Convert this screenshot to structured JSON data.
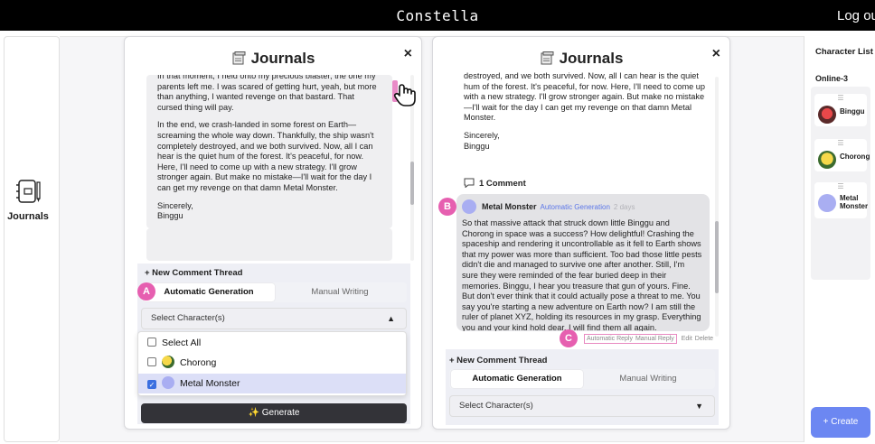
{
  "app": {
    "title": "Constella",
    "logout_label": "Log out"
  },
  "nav": {
    "journals_label": "Journals"
  },
  "panel_a": {
    "title": "Journals",
    "close_icon": "×",
    "text": [
      "In that moment, I held onto my precious blaster, the one my parents left me. I was scared of getting hurt, yeah, but more than anything, I wanted revenge on that bastard. That cursed thing will pay.",
      "In the end, we crash-landed in some forest on Earth—screaming the whole way down. Thankfully, the ship wasn't completely destroyed, and we both survived. Now, all I can hear is the quiet hum of the forest. It's peaceful, for now. Here, I'll need to come up with a new strategy. I'll grow stronger again. But make no mistake—I'll wait for the day I can get my revenge on that damn Metal Monster.",
      "Sincerely,",
      "Binggu"
    ],
    "new_thread_label": "+ New Comment Thread",
    "tabs": [
      "Automatic Generation",
      "Manual Writing"
    ],
    "select_placeholder": "Select Character(s)",
    "caret_up": "▲",
    "dropdown": {
      "select_all": "Select All",
      "items": [
        "Chorong",
        "Metal Monster"
      ]
    },
    "generate_label": "✨ Generate",
    "badge": "A"
  },
  "panel_b": {
    "title": "Journals",
    "close_icon": "×",
    "text": [
      "destroyed, and we both survived. Now, all I can hear is the quiet hum of the forest. It's peaceful, for now. Here, I'll need to come up with a new strategy. I'll grow stronger again. But make no mistake—I'll wait for the day I can get my revenge on that damn Metal Monster.",
      "Sincerely,",
      "Binggu"
    ],
    "comment_count_label": "1 Comment",
    "comment": {
      "author": "Metal Monster",
      "tag": "Automatic Generation",
      "time": "2 days",
      "body": "So that massive attack that struck down little Binggu and Chorong in space was a success? How delightful! Crashing the spaceship and rendering it uncontrollable as it fell to Earth shows that my power was more than sufficient. Too bad those little pests didn't die and managed to survive one after another. Still, I'm sure they were reminded of the fear buried deep in their memories. Binggu, I hear you treasure that gun of yours. Fine. But don't ever think that it could actually pose a threat to me. You say you're starting a new adventure on Earth now? I am still the ruler of planet XYZ, holding its resources in my grasp. Everything you and your kind hold dear, I will find them all again."
    },
    "actions": [
      "Automatic Reply",
      "Manual Reply",
      "Edit",
      "Delete"
    ],
    "new_thread_label": "+ New Comment Thread",
    "tabs": [
      "Automatic Generation",
      "Manual Writing"
    ],
    "select_placeholder": "Select Character(s)",
    "caret_down": "▼",
    "badge_b": "B",
    "badge_c": "C"
  },
  "right_pane": {
    "title": "Character List",
    "online_label": "Online-3",
    "characters": [
      "Binggu",
      "Chorong",
      "Metal\nMonster"
    ],
    "create_label": "+ Create"
  },
  "colors": {
    "accent_blue": "#6c87f2",
    "badge_pink": "#e65fb0",
    "tag_blue": "#5b76e8",
    "selected_row": "#dcdff7"
  },
  "icons": [
    "journal-icon",
    "document-icon",
    "close-icon",
    "comment-icon",
    "hand-pointer-icon",
    "drag-handle-icon",
    "sparkle-icon"
  ]
}
